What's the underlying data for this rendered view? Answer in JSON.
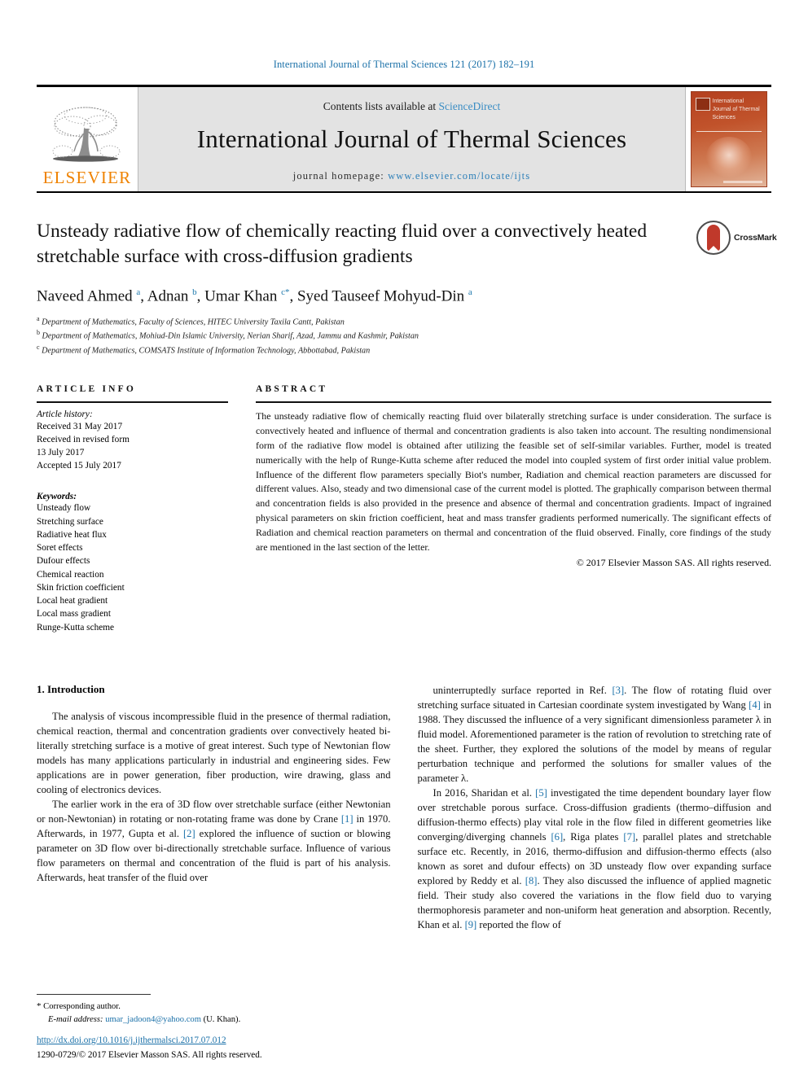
{
  "running_head": "International Journal of Thermal Sciences 121 (2017) 182–191",
  "masthead": {
    "contents_prefix": "Contents lists available at ",
    "sciencedirect": "ScienceDirect",
    "journal_title": "International Journal of Thermal Sciences",
    "homepage_prefix": "journal homepage: ",
    "homepage_url": "www.elsevier.com/locate/ijts",
    "publisher": "ELSEVIER",
    "cover_title": "International Journal of Thermal Sciences",
    "link_color": "#2d7fb8",
    "brand_orange": "#ef8200",
    "cover_color": "#b4401f"
  },
  "article": {
    "title": "Unsteady radiative flow of chemically reacting fluid over a convectively heated stretchable surface with cross-diffusion gradients",
    "crossmark_label": "CrossMark",
    "authors_html": "Naveed Ahmed <sup>a</sup>, Adnan <sup>b</sup>, Umar Khan <sup>c</sup><sup class=\"ast\">*</sup>, Syed Tauseef Mohyud-Din <sup>a</sup>",
    "affiliations": [
      {
        "mark": "a",
        "text": "Department of Mathematics, Faculty of Sciences, HITEC University Taxila Cantt, Pakistan"
      },
      {
        "mark": "b",
        "text": "Department of Mathematics, Mohiud-Din Islamic University, Nerian Sharif, Azad, Jammu and Kashmir, Pakistan"
      },
      {
        "mark": "c",
        "text": "Department of Mathematics, COMSATS Institute of Information Technology, Abbottabad, Pakistan"
      }
    ]
  },
  "article_info": {
    "heading": "ARTICLE INFO",
    "history_label": "Article history:",
    "history_lines": [
      "Received 31 May 2017",
      "Received in revised form",
      "13 July 2017",
      "Accepted 15 July 2017"
    ],
    "keywords_label": "Keywords:",
    "keywords": [
      "Unsteady flow",
      "Stretching surface",
      "Radiative heat flux",
      "Soret effects",
      "Dufour effects",
      "Chemical reaction",
      "Skin friction coefficient",
      "Local heat gradient",
      "Local mass gradient",
      "Runge-Kutta scheme"
    ]
  },
  "abstract": {
    "heading": "ABSTRACT",
    "text": "The unsteady radiative flow of chemically reacting fluid over bilaterally stretching surface is under consideration. The surface is convectively heated and influence of thermal and concentration gradients is also taken into account. The resulting nondimensional form of the radiative flow model is obtained after utilizing the feasible set of self-similar variables. Further, model is treated numerically with the help of Runge-Kutta scheme after reduced the model into coupled system of first order initial value problem. Influence of the different flow parameters specially Biot's number, Radiation and chemical reaction parameters are discussed for different values. Also, steady and two dimensional case of the current model is plotted. The graphically comparison between thermal and concentration fields is also provided in the presence and absence of thermal and concentration gradients. Impact of ingrained physical parameters on skin friction coefficient, heat and mass transfer gradients performed numerically. The significant effects of Radiation and chemical reaction parameters on thermal and concentration of the fluid observed. Finally, core findings of the study are mentioned in the last section of the letter.",
    "copyright": "© 2017 Elsevier Masson SAS. All rights reserved."
  },
  "introduction": {
    "section_title": "1. Introduction",
    "left_paragraphs": [
      "The analysis of viscous incompressible fluid in the presence of thermal radiation, chemical reaction, thermal and concentration gradients over convectively heated bi-literally stretching surface is a motive of great interest. Such type of Newtonian flow models has many applications particularly in industrial and engineering sides. Few applications are in power generation, fiber production, wire drawing, glass and cooling of electronics devices.",
      "The earlier work in the era of 3D flow over stretchable surface (either Newtonian or non-Newtonian) in rotating or non-rotating frame was done by Crane [1] in 1970. Afterwards, in 1977, Gupta et al. [2] explored the influence of suction or blowing parameter on 3D flow over bi-directionally stretchable surface. Influence of various flow parameters on thermal and concentration of the fluid is part of his analysis. Afterwards, heat transfer of the fluid over"
    ],
    "right_paragraphs": [
      "uninterruptedly surface reported in Ref. [3]. The flow of rotating fluid over stretching surface situated in Cartesian coordinate system investigated by Wang [4] in 1988. They discussed the influence of a very significant dimensionless parameter λ in fluid model. Aforementioned parameter is the ration of revolution to stretching rate of the sheet. Further, they explored the solutions of the model by means of regular perturbation technique and performed the solutions for smaller values of the parameter λ.",
      "In 2016, Sharidan et al. [5] investigated the time dependent boundary layer flow over stretchable porous surface. Cross-diffusion gradients (thermo–diffusion and diffusion-thermo effects) play vital role in the flow filed in different geometries like converging/diverging channels [6], Riga plates [7], parallel plates and stretchable surface etc. Recently, in 2016, thermo-diffusion and diffusion-thermo effects (also known as soret and dufour effects) on 3D unsteady flow over expanding surface explored by Reddy et al. [8]. They also discussed the influence of applied magnetic field. Their study also covered the variations in the flow field duo to varying thermophoresis parameter and non-uniform heat generation and absorption. Recently, Khan et al. [9] reported the flow of"
    ]
  },
  "footer": {
    "corresponding_star": "*",
    "corresponding_label": "Corresponding author.",
    "email_label": "E-mail address:",
    "email": "umar_jadoon4@yahoo.com",
    "email_owner": "(U. Khan).",
    "doi": "http://dx.doi.org/10.1016/j.ijthermalsci.2017.07.012",
    "issn_line": "1290-0729/© 2017 Elsevier Masson SAS. All rights reserved."
  }
}
